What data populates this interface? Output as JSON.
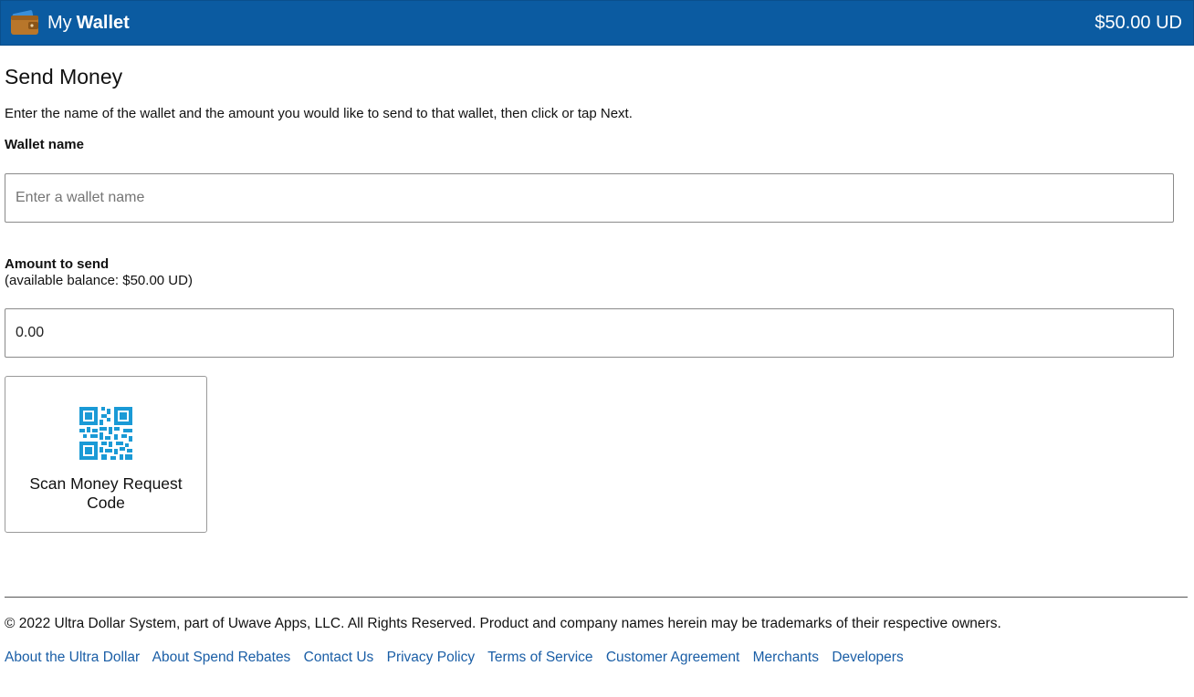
{
  "header": {
    "title_prefix": "My",
    "title_main": "Wallet",
    "balance": "$50.00 UD",
    "icon": "wallet-icon"
  },
  "main": {
    "title": "Send Money",
    "intro": "Enter the name of the wallet and the amount you would like to send to that wallet, then click or tap Next.",
    "wallet_field": {
      "label": "Wallet name",
      "placeholder": "Enter a wallet name",
      "value": ""
    },
    "amount_field": {
      "label": "Amount to send",
      "sublabel": "(available balance: $50.00 UD)",
      "value": "0.00"
    },
    "scan_button": {
      "label": "Scan Money Request Code",
      "icon": "qr-code-icon"
    }
  },
  "footer": {
    "copyright": "© 2022 Ultra Dollar System, part of Uwave Apps, LLC. All Rights Reserved. Product and company names herein may be trademarks of their respective owners.",
    "links": [
      "About the Ultra Dollar",
      "About Spend Rebates",
      "Contact Us",
      "Privacy Policy",
      "Terms of Service",
      "Customer Agreement",
      "Merchants",
      "Developers"
    ]
  },
  "colors": {
    "header_bg": "#0b5ba1",
    "link": "#1a5ea6",
    "qr_icon": "#1a9ad6",
    "wallet_icon": "#b8762a"
  }
}
